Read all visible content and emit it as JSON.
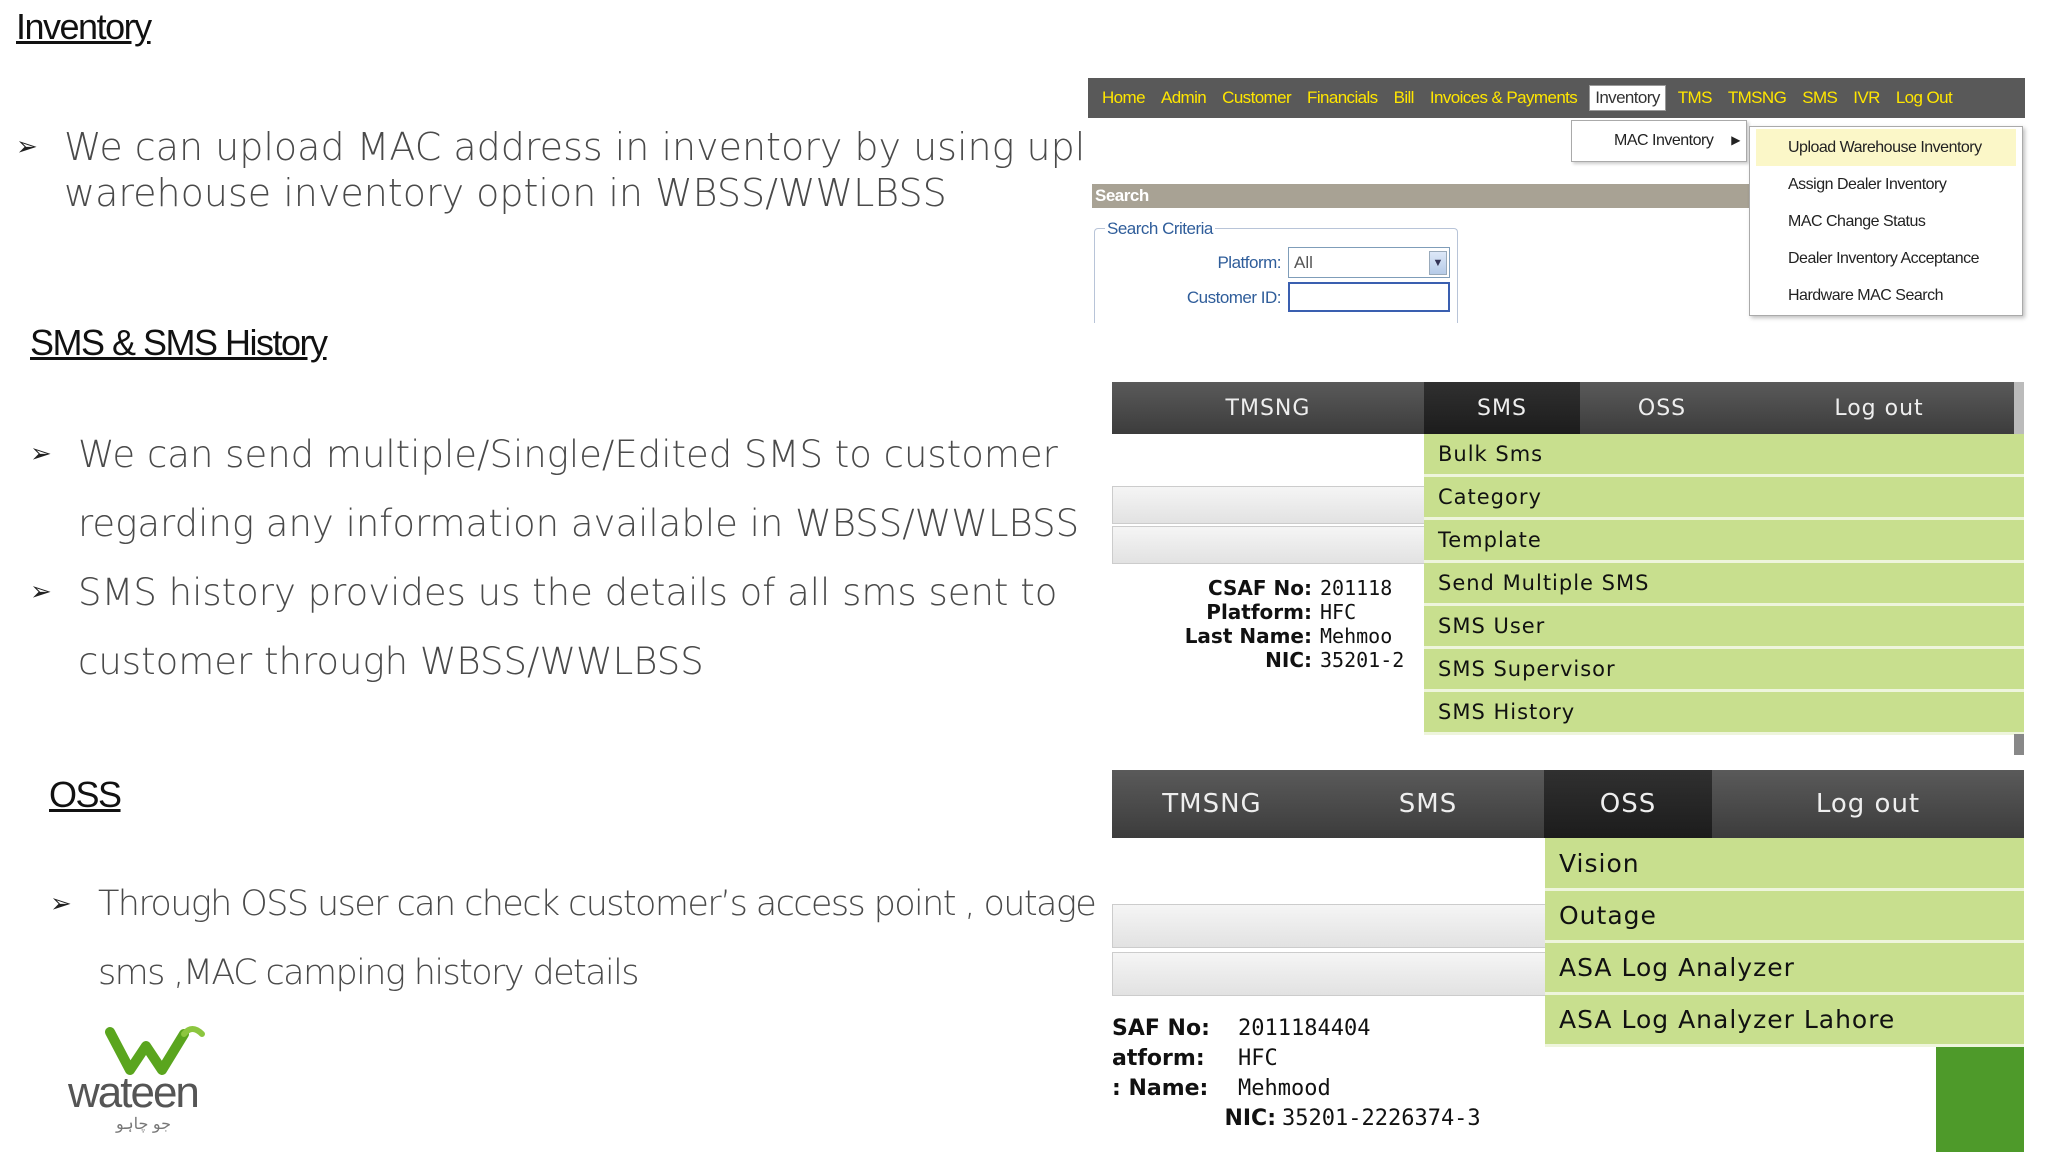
{
  "inventory": {
    "heading": "Inventory",
    "bullets": [
      "We can upload MAC address in inventory by using upload",
      "warehouse inventory option in WBSS/WWLBSS"
    ]
  },
  "sms": {
    "heading": "SMS  & SMS History",
    "bullet1": [
      "We can send multiple/Single/Edited SMS to customer",
      "regarding any information available in WBSS/WWLBSS"
    ],
    "bullet2": [
      "SMS history provides us the details of all sms sent to",
      "customer  through WBSS/WWLBSS"
    ]
  },
  "oss": {
    "heading": "OSS",
    "bullet": [
      "Through OSS user can check customer’s  access point , outage",
      "sms ,MAC camping history details"
    ]
  },
  "logo": {
    "name": "wateen",
    "tagline": "جو چاہو"
  },
  "shot1": {
    "nav": [
      "Home",
      "Admin",
      "Customer",
      "Financials",
      "Bill",
      "Invoices & Payments",
      "Inventory",
      "TMS",
      "TMSNG",
      "SMS",
      "IVR",
      "Log Out"
    ],
    "submenu": "MAC Inventory",
    "menu": [
      "Upload Warehouse Inventory",
      "Assign Dealer Inventory",
      "MAC Change Status",
      "Dealer Inventory Acceptance",
      "Hardware MAC Search"
    ],
    "search_title": "Search",
    "criteria": "Search Criteria",
    "platform_label": "Platform:",
    "platform_value": "All",
    "customer_label": "Customer ID:"
  },
  "shot2": {
    "tabs": [
      "TMSNG",
      "SMS",
      "OSS",
      "Log out"
    ],
    "menu": [
      "Bulk Sms",
      "Category",
      "Template",
      "Send Multiple SMS",
      "SMS User",
      "SMS Supervisor",
      "SMS History"
    ],
    "info": [
      [
        "CSAF No:",
        "201118"
      ],
      [
        "Platform:",
        "HFC"
      ],
      [
        "Last Name:",
        "Mehmoo"
      ],
      [
        "NIC:",
        "35201-2"
      ]
    ]
  },
  "shot3": {
    "tabs": [
      "TMSNG",
      "SMS",
      "OSS",
      "Log out"
    ],
    "menu": [
      "Vision",
      "Outage",
      "ASA Log Analyzer",
      "ASA Log Analyzer Lahore"
    ],
    "info": [
      [
        "SAF No:",
        "2011184404"
      ],
      [
        "atform:",
        "HFC"
      ],
      [
        ": Name:",
        "Mehmood"
      ],
      [
        "NIC:",
        "35201-2226374-3"
      ]
    ]
  },
  "colors": {
    "nav_text": "#ffe600",
    "menu_green": "#c8df8e",
    "logo_green": "#5aa51e"
  }
}
